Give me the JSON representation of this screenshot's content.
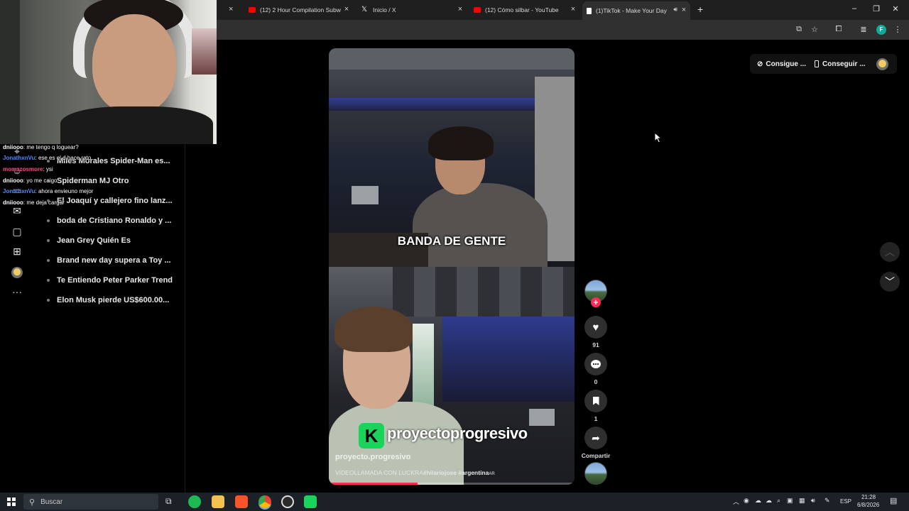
{
  "browser": {
    "tabs": [
      {
        "label": "(12) 2 Hour Compilation Subw",
        "favicon": "youtube-icon"
      },
      {
        "label": "Inicio / X",
        "favicon": "x-logo-icon"
      },
      {
        "label": "(12) Cómo silbar - YouTube",
        "favicon": "youtube-icon"
      },
      {
        "label": "(1)TikTok - Make Your Day",
        "favicon": "tiktok-icon"
      }
    ],
    "profile_initial": "F"
  },
  "chat": [
    {
      "user": "dniiooo",
      "message": "me tengo q loguear?"
    },
    {
      "user": "JonathxnVu",
      "message": "ese es el d hace rato"
    },
    {
      "user": "momazosmore",
      "message": "ysi"
    },
    {
      "user": "dniiooo",
      "message": "yo me caigo"
    },
    {
      "user": "JonathxnVu",
      "message": "ahora envieuno mejor"
    },
    {
      "user": "dniiooo",
      "message": "me deja cargar"
    }
  ],
  "sidebar": {
    "trends": [
      "Miles Morales Spider-Man es...",
      "Spiderman MJ Otro",
      "El Joaquí y callejero fino lanz...",
      "boda de Cristiano Ronaldo y ...",
      "Jean Grey Quién Es",
      "Brand new day supera a Toy ...",
      "Te Entiendo Peter Parker Trend",
      "Elon Musk pierde US$600.00..."
    ]
  },
  "top_right": {
    "get_coins": "Consigue ...",
    "get_app": "Conseguir ..."
  },
  "video": {
    "overlay_caption": "BANDA DE GENTE",
    "logo_letter": "K",
    "logo_text": "proyectoprogresivo",
    "author": "proyecto.progresivo",
    "description": "VIDEOLLAMADA CON LUCKRA",
    "hashtags": "#hilariojose #argentina",
    "hashtag_suffix": "AR",
    "progress": 0.36
  },
  "actions": {
    "likes": "91",
    "comments": "0",
    "saves": "1",
    "share": "Compartir"
  },
  "taskbar": {
    "search_placeholder": "Buscar",
    "language": "ESP",
    "time": "21:28",
    "date": "6/8/2026"
  },
  "colors": {
    "tiktok_red": "#fe2c55",
    "logo_green": "#19d45a",
    "background": "#000000"
  }
}
